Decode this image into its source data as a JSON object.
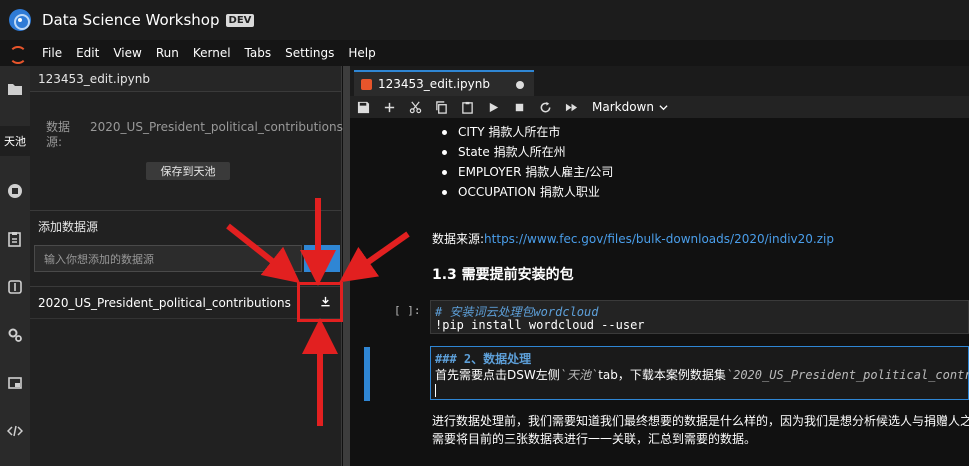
{
  "titlebar": {
    "title": "Data Science Workshop",
    "badge": "DEV"
  },
  "menubar": {
    "items": [
      "File",
      "Edit",
      "View",
      "Run",
      "Kernel",
      "Tabs",
      "Settings",
      "Help"
    ]
  },
  "activitybar": {
    "tianchi_label": "天池"
  },
  "sidepanel": {
    "header": "123453_edit.ipynb",
    "datasource_label": "数据源:",
    "datasource_value": "2020_US_President_political_contributions",
    "save_button": "保存到天池",
    "add_title": "添加数据源",
    "add_placeholder": "输入你想添加的数据源",
    "file_name": "2020_US_President_political_contributions"
  },
  "notebook": {
    "tab_label": "123453_edit.ipynb",
    "cell_type": "Markdown",
    "bullets": [
      "CITY 捐款人所在市",
      "State 捐款人所在州",
      "EMPLOYER 捐款人雇主/公司",
      "OCCUPATION 捐款人职业"
    ],
    "source_prefix": "数据来源:",
    "source_link": "https://www.fec.gov/files/bulk-downloads/2020/indiv20.zip",
    "heading": "1.3 需要提前安装的包",
    "prompt": "[ ]:",
    "code_comment": "# 安装词云处理包wordcloud",
    "code_line": "!pip install wordcloud --user",
    "md_heading": "### 2、数据处理",
    "md_line_a": "首先需要点击DSW左侧",
    "md_code_a": "`天池`",
    "md_line_b": "tab，下载本案例数据集",
    "md_code_b": "`2020_US_President_political_contri",
    "para_1": "进行数据处理前，我们需要知道我们最终想要的数据是什么样的，因为我们是想分析候选人与捐赠人之",
    "para_2": "需要将目前的三张数据表进行一一关联，汇总到需要的数据。"
  },
  "colors": {
    "accent": "#2f86d4",
    "annotation": "#e22020",
    "background": "#111111"
  }
}
